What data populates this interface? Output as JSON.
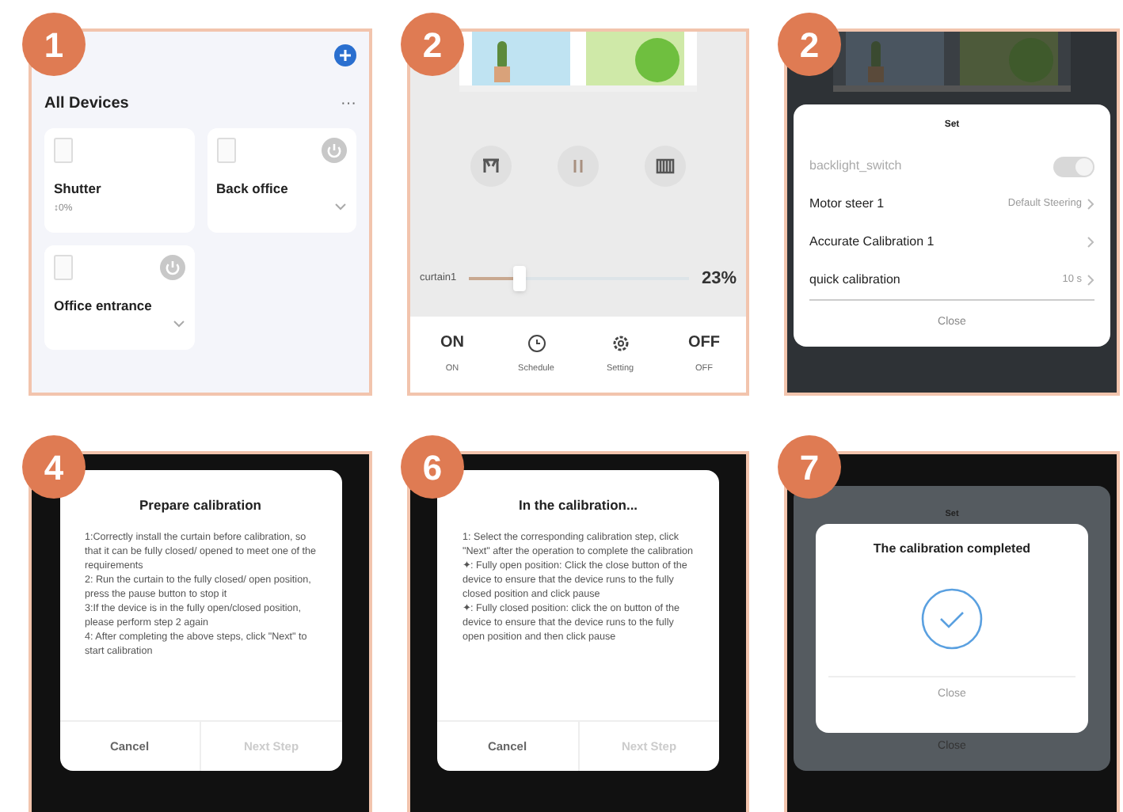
{
  "steps": [
    {
      "badge": "1",
      "kind": "devices",
      "title": "All Devices",
      "menu": "···",
      "devices": [
        {
          "kind": "shutter",
          "name": "Shutter",
          "status": "↕0%"
        },
        {
          "kind": "switch",
          "name": "Back office"
        },
        {
          "kind": "switch",
          "name": "Office entrance"
        }
      ]
    },
    {
      "badge": "2",
      "kind": "curtain",
      "slider": {
        "label": "curtain1",
        "level": 0.23,
        "reading": "23%"
      },
      "actions": [
        {
          "kind": "text",
          "glyph": "ON",
          "label": "ON"
        },
        {
          "kind": "clock",
          "label": "Schedule"
        },
        {
          "kind": "gear",
          "label": "Setting"
        },
        {
          "kind": "text",
          "glyph": "OFF",
          "label": "OFF"
        }
      ]
    },
    {
      "badge": "2",
      "kind": "settings",
      "title": "Set",
      "rows": [
        {
          "kind": "toggle",
          "label": "backlight_switch",
          "on": true,
          "disabled": true
        },
        {
          "kind": "link",
          "label": "Motor steer 1",
          "value": "Default Steering"
        },
        {
          "kind": "link",
          "label": "Accurate Calibration 1"
        },
        {
          "kind": "link",
          "label": "quick calibration",
          "value": "10 s"
        }
      ],
      "close": "Close"
    },
    {
      "badge": "4",
      "kind": "dialog",
      "title": "Prepare calibration",
      "paragraphs": [
        "1:Correctly install the curtain before calibration, so that it can be fully closed/ opened to meet one of the requirements",
        "2: Run the curtain to the fully closed/ open position, press the pause button to stop it",
        "3:If the device is in the fully open/closed position, please perform step 2 again",
        "4: After completing the above steps, click \"Next\" to start calibration"
      ],
      "buttons": [
        {
          "label": "Cancel",
          "disabled": false
        },
        {
          "label": "Next Step",
          "disabled": true
        }
      ]
    },
    {
      "badge": "6",
      "kind": "dialog",
      "title": "In the calibration...",
      "paragraphs": [
        "1: Select the corresponding calibration step, click \"Next\" after the operation to complete the calibration",
        "✦: Fully open position: Click the close button of the device to ensure that the device runs to the fully closed position and click pause",
        "✦: Fully closed position: click the on button of the device to ensure that the device runs to the fully open position and then click pause"
      ],
      "buttons": [
        {
          "label": "Cancel",
          "disabled": false
        },
        {
          "label": "Next Step",
          "disabled": true
        }
      ]
    },
    {
      "badge": "7",
      "kind": "done",
      "sheet_title": "Set",
      "sheet_close": "Close",
      "title": "The calibration completed",
      "close": "Close"
    }
  ]
}
